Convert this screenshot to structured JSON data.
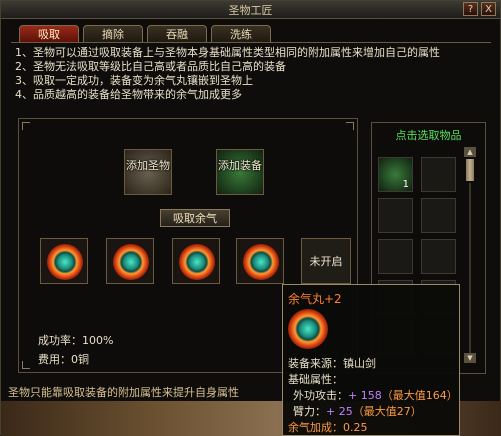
{
  "window": {
    "title": "圣物工匠",
    "help_label": "?",
    "close_label": "X"
  },
  "tabs": [
    {
      "label": "吸取",
      "active": true
    },
    {
      "label": "摘除",
      "active": false
    },
    {
      "label": "吞融",
      "active": false
    },
    {
      "label": "洗练",
      "active": false
    }
  ],
  "rules": [
    "1、圣物可以通过吸取装备上与圣物本身基础属性类型相同的附加属性来增加自己的属性",
    "2、圣物无法吸取等级比自己高或者品质比自己高的装备",
    "3、吸取一定成功，装备变为余气丸镶嵌到圣物上",
    "4、品质越高的装备给圣物带来的余气加成更多"
  ],
  "slots": {
    "relic_label": "添加圣物",
    "equip_label": "添加装备"
  },
  "absorb_button": "吸取余气",
  "orbs": {
    "count": 4,
    "locked_label": "未开启"
  },
  "stats": {
    "success_rate": "成功率：100%",
    "cost": "费用：0铜"
  },
  "right_panel": {
    "header": "点击选取物品",
    "item_count": "1"
  },
  "footer": "圣物只能靠吸取装备的附加属性来提升自身属性",
  "tooltip": {
    "title": "余气丸+2",
    "source": "装备来源：镇山剑",
    "base_attr_label": "基础属性：",
    "line1_label": "外功攻击：",
    "line1_value": "+ 158",
    "line1_max": "（最大值164）",
    "line2_label": "臂力：",
    "line2_value": "+ 25",
    "line2_max": "（最大值27）",
    "bonus": "余气加成：0.25"
  },
  "colors": {
    "active_tab": "#9a2a1a",
    "header_green": "#5ae05a",
    "tooltip_title": "#ff8030",
    "purple_value": "#c080ff"
  }
}
